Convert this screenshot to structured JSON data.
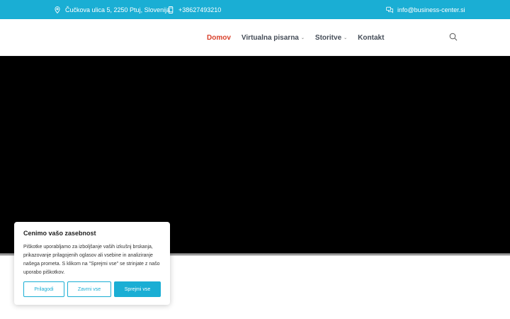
{
  "topbar": {
    "address": "Čučkova ulica 5, 2250 Ptuj, Slovenija",
    "phone": "+38627493210",
    "email": "info@business-center.si"
  },
  "nav": {
    "items": [
      {
        "label": "Domov",
        "active": true
      },
      {
        "label": "Virtualna pisarna",
        "dropdown": true
      },
      {
        "label": "Storitve",
        "dropdown": true
      },
      {
        "label": "Kontakt"
      }
    ],
    "chevron": "⌄"
  },
  "cookie": {
    "title": "Cenimo vašo zasebnost",
    "text": "Piškotke uporabljamo za izboljšanje vaših izkušnj brskanja, prikazovanje prilagojenih oglasov ali vsebine in analiziranje našega prometa. S klikom na \"Sprejmi vse\" se strinjate z našo uporabo piškotkov.",
    "buttons": {
      "customize": "Prilagodi",
      "reject": "Zavrni vse",
      "accept": "Sprejmi vse"
    }
  },
  "colors": {
    "accent": "#1aaed4",
    "active_nav": "#d9412b",
    "hero": "#000000"
  },
  "icons": {
    "address": "location-pin-icon",
    "phone": "phone-icon",
    "email": "chat-icon",
    "search": "search-icon"
  }
}
